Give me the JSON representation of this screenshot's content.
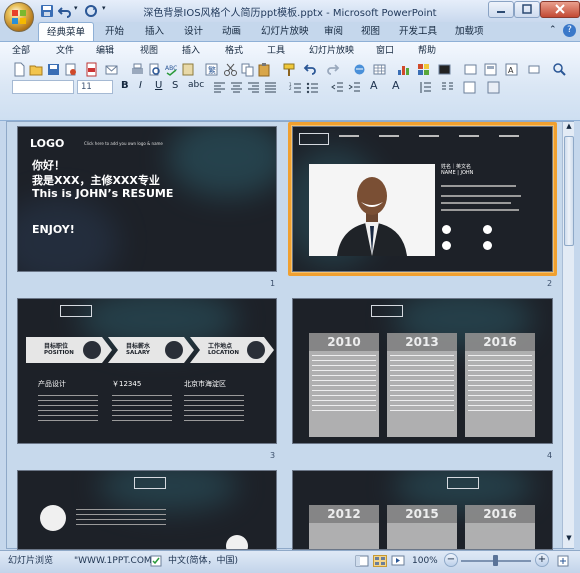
{
  "window": {
    "title": "深色背景IOS风格个人简历ppt模板.pptx - Microsoft PowerPoint"
  },
  "ribbon_tabs": [
    "经典菜单",
    "开始",
    "插入",
    "设计",
    "动画",
    "幻灯片放映",
    "审阅",
    "视图",
    "开发工具",
    "加载项"
  ],
  "menu_items": [
    "全部",
    "文件",
    "编辑",
    "视图",
    "插入",
    "格式",
    "工具",
    "幻灯片放映",
    "窗口",
    "帮助"
  ],
  "font_size_value": "11",
  "slides": [
    {
      "number": "1",
      "logo": "LOGO",
      "logo_hint": "Click here to add you own logo & name",
      "line1": "你好！",
      "line2": "我是XXX，主修XXX专业",
      "line3": "This is JOHN’s RESUME",
      "line4": "ENJOY!"
    },
    {
      "number": "2",
      "name_label": "姓名｜英文名",
      "name_en": "NAME | JOHN"
    },
    {
      "number": "3",
      "arrow1_cn": "目标职位",
      "arrow1_en": "POSITION",
      "arrow2_cn": "目标薪水",
      "arrow2_en": "SALARY",
      "arrow3_cn": "工作地点",
      "arrow3_en": "LOCATION",
      "val1": "产品设计",
      "val2": "￥12345",
      "val3": "北京市海淀区"
    },
    {
      "number": "4",
      "years": [
        "2010",
        "2013",
        "2016"
      ]
    },
    {
      "number": "",
      "years": [
        "2012",
        "2015",
        "2016"
      ]
    }
  ],
  "statusbar": {
    "view": "幻灯片浏览",
    "theme": "\"WWW.1PPT.COM\"",
    "language": "中文(简体，中国)",
    "zoom": "100%"
  },
  "colors": {
    "ribbon_bg": "#dbe7f5",
    "slide_bg": "#1d2128",
    "selected_border": "#f0a030"
  }
}
